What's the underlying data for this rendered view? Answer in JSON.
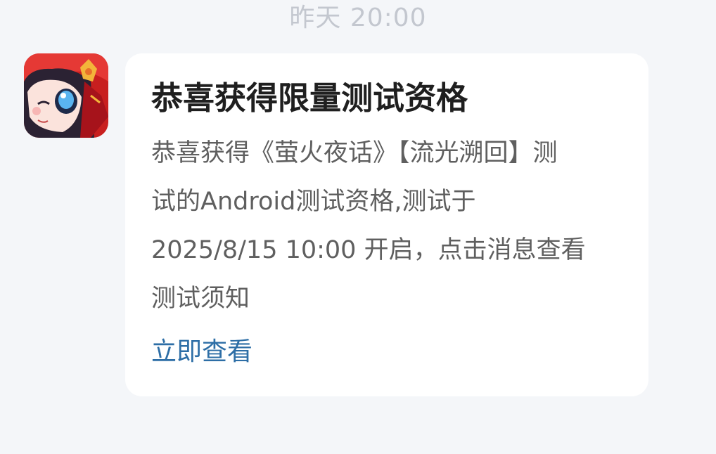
{
  "timestamp": "昨天  20:00",
  "avatar": {
    "icon": "game-app-icon",
    "colors": {
      "background": "#c81f1f",
      "hair": "#2b2233",
      "skin": "#fbe3dc",
      "eye": "#5ab4f0",
      "ornament": "#f3b53a"
    }
  },
  "notification": {
    "title": "恭喜获得限量测试资格",
    "body_lines": [
      "恭喜获得《萤火夜话》【流光溯回】测",
      "试的Android测试资格,测试于",
      "2025/8/15 10:00 开启，点击消息查看",
      "测试须知"
    ],
    "action_label": "立即查看",
    "action_color": "#2d6ea6"
  }
}
